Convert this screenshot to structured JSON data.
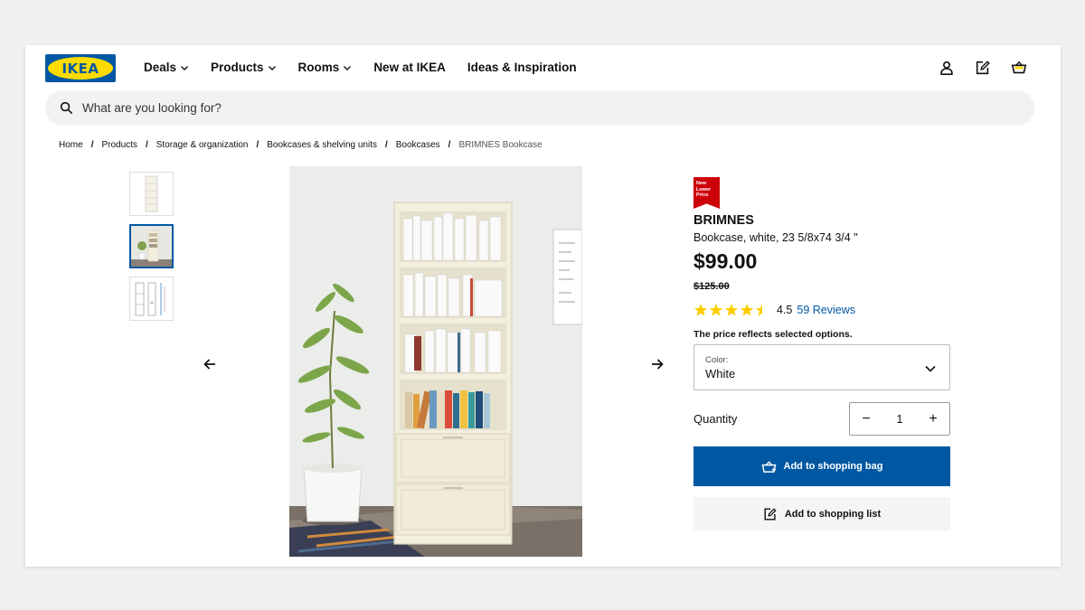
{
  "logo": {
    "text": "IKEA"
  },
  "nav": [
    {
      "label": "Deals",
      "dropdown": true
    },
    {
      "label": "Products",
      "dropdown": true
    },
    {
      "label": "Rooms",
      "dropdown": true
    },
    {
      "label": "New at IKEA",
      "dropdown": false
    },
    {
      "label": "Ideas & Inspiration",
      "dropdown": false
    }
  ],
  "top_icons": [
    "user-icon",
    "shopping-list-icon",
    "shopping-bag-icon"
  ],
  "search": {
    "placeholder": "What are you looking for?"
  },
  "breadcrumb": {
    "items": [
      "Home",
      "Products",
      "Storage & organization",
      "Bookcases & shelving units",
      "Bookcases"
    ],
    "current": "BRIMNES Bookcase",
    "separator": "/"
  },
  "gallery": {
    "thumbnail_count": 3,
    "selected_index": 1
  },
  "product": {
    "badge": [
      "New",
      "Lower",
      "Price"
    ],
    "name": "BRIMNES",
    "description": "Bookcase, white, 23 5/8x74 3/4 \"",
    "price": "$99.00",
    "old_price": "$125.00",
    "rating_value": "4.5",
    "rating_stars": 4.5,
    "rating_max": 5,
    "reviews": "59 Reviews",
    "price_note": "The price reflects selected options.",
    "color_label": "Color:",
    "color_value": "White",
    "quantity_label": "Quantity",
    "quantity": "1",
    "decrement": "−",
    "increment": "+",
    "add_to_bag": "Add to shopping bag",
    "add_to_list": "Add to shopping list"
  },
  "colors": {
    "ikea_blue": "#0058a3",
    "ikea_yellow": "#ffdb00",
    "badge_red": "#cc0008",
    "star": "#ffcd00"
  }
}
